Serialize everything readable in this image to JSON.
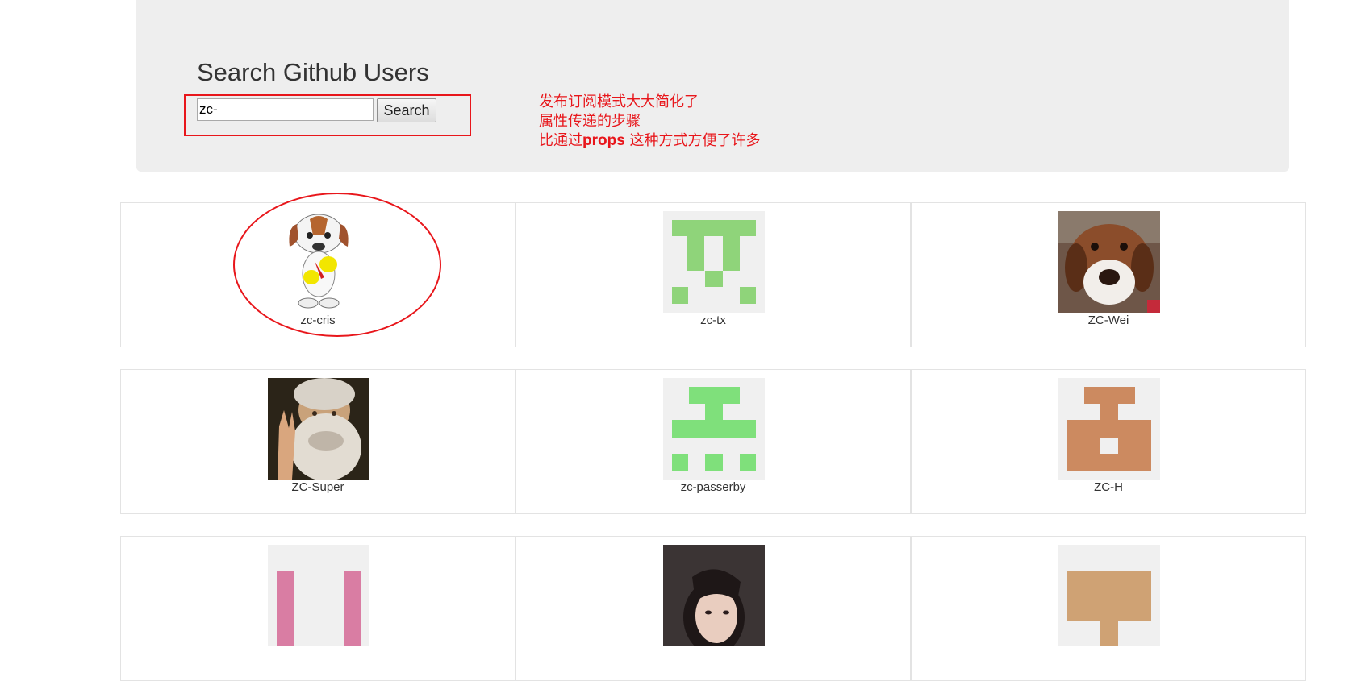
{
  "header": {
    "title": "Search Github Users",
    "search_value": "zc-",
    "search_button": "Search"
  },
  "annotation": {
    "line1": "发布订阅模式大大简化了",
    "line2": "属性传递的步骤",
    "line3_prefix": "比通过",
    "line3_highlight": "props",
    "line3_suffix": " 这种方式方便了许多",
    "color": "#e8161b"
  },
  "users": [
    {
      "login": "zc-cris",
      "avatar": "cartoon-dog-avatar"
    },
    {
      "login": "zc-tx",
      "avatar": "identicon-green-avatar"
    },
    {
      "login": "ZC-Wei",
      "avatar": "plush-dog-photo-avatar"
    },
    {
      "login": "ZC-Super",
      "avatar": "bearded-man-photo-avatar"
    },
    {
      "login": "zc-passerby",
      "avatar": "identicon-green-avatar"
    },
    {
      "login": "ZC-H",
      "avatar": "identicon-brown-avatar"
    },
    {
      "login": "",
      "avatar": "identicon-pink-avatar"
    },
    {
      "login": "",
      "avatar": "woman-photo-avatar"
    },
    {
      "login": "",
      "avatar": "identicon-tan-avatar"
    }
  ]
}
